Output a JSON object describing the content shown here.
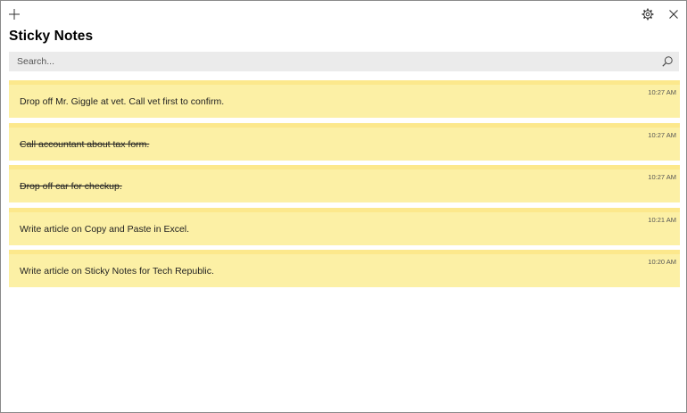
{
  "app": {
    "title": "Sticky Notes"
  },
  "titlebar": {
    "buttons": [
      {
        "name": "add-note-button",
        "icon": "plus-icon"
      },
      {
        "name": "settings-button",
        "icon": "gear-icon"
      },
      {
        "name": "close-button",
        "icon": "close-icon"
      }
    ]
  },
  "search": {
    "placeholder": "Search...",
    "value": "",
    "icon": "search-icon"
  },
  "colors": {
    "note_background": "#fcf0a5",
    "note_header": "#fce88c",
    "search_background": "#ebebeb"
  },
  "notes": [
    {
      "text": "Drop off Mr. Giggle at vet. Call vet first to confirm.",
      "time": "10:27 AM",
      "done": false
    },
    {
      "text": "Call accountant about tax form.",
      "time": "10:27 AM",
      "done": true
    },
    {
      "text": "Drop off car for checkup.",
      "time": "10:27 AM",
      "done": true
    },
    {
      "text": "Write article on Copy and Paste in Excel.",
      "time": "10:21 AM",
      "done": false
    },
    {
      "text": "Write article on Sticky Notes for Tech Republic.",
      "time": "10:20 AM",
      "done": false
    }
  ]
}
